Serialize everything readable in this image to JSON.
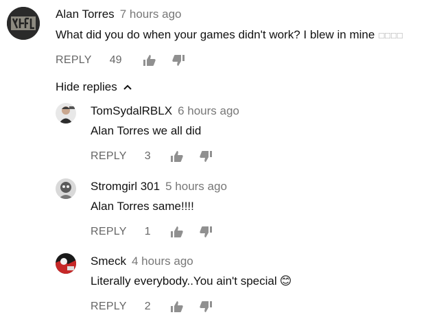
{
  "main_comment": {
    "author": "Alan Torres",
    "time": "7 hours ago",
    "text": "What did you do when your games didn't work? I blew in mine",
    "emoji_placeholder": "□□□□",
    "reply_label": "REPLY",
    "likes": "49"
  },
  "hide_replies_label": "Hide replies",
  "replies": [
    {
      "author": "TomSydalRBLX",
      "time": "6 hours ago",
      "text": "Alan Torres we all did",
      "reply_label": "REPLY",
      "likes": "3"
    },
    {
      "author": "Stromgirl 301",
      "time": "5 hours ago",
      "text": "Alan Torres same!!!!",
      "reply_label": "REPLY",
      "likes": "1"
    },
    {
      "author": "Smeck",
      "time": "4 hours ago",
      "text": "Literally everybody..You ain't special",
      "emoji": "😊",
      "reply_label": "REPLY",
      "likes": "2"
    }
  ]
}
